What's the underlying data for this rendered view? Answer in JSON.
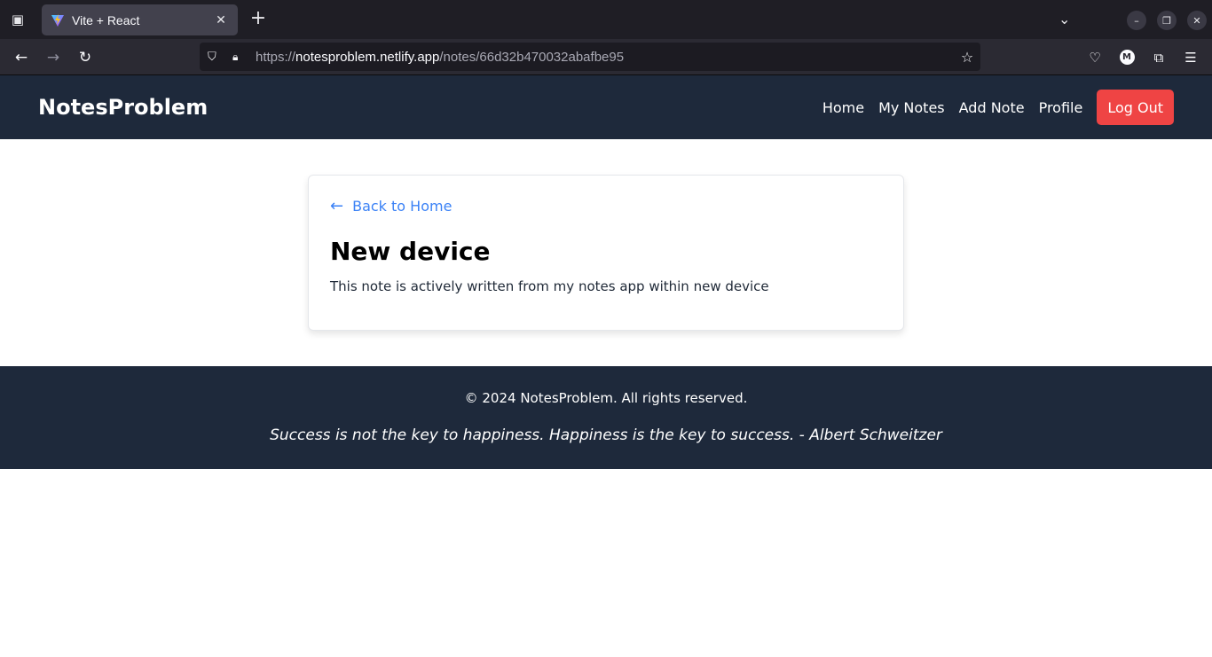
{
  "browser": {
    "tab_title": "Vite + React",
    "url_scheme": "https://",
    "url_host": "notesproblem.netlify.app",
    "url_path": "/notes/66d32b470032abafbe95",
    "account_initial": "M"
  },
  "header": {
    "brand": "NotesProblem",
    "nav": {
      "home": "Home",
      "my_notes": "My Notes",
      "add_note": "Add Note",
      "profile": "Profile"
    },
    "logout_label": "Log Out"
  },
  "note": {
    "back_label": "Back to Home",
    "title": "New device",
    "body": "This note is actively written from my notes app within new device"
  },
  "footer": {
    "copyright": "© 2024 NotesProblem. All rights reserved.",
    "quote": "Success is not the key to happiness. Happiness is the key to success. - Albert Schweitzer"
  },
  "colors": {
    "header_bg": "#1e293b",
    "logout_bg": "#ef4444",
    "link": "#3b82f6"
  }
}
